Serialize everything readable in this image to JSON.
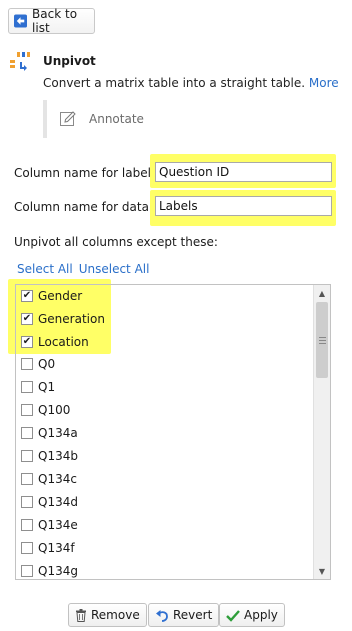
{
  "back_button": {
    "label": "Back to list"
  },
  "header": {
    "title": "Unpivot",
    "description": "Convert a matrix table into a straight table.",
    "more_link": "More"
  },
  "annotate": {
    "label": "Annotate"
  },
  "fields": {
    "labels_name": {
      "label": "Column name for labels",
      "value": "Question ID"
    },
    "data_name": {
      "label": "Column name for data",
      "value": "Labels"
    }
  },
  "columns_section": {
    "label": "Unpivot all columns except these:",
    "select_all": "Select All",
    "unselect_all": "Unselect All",
    "items": [
      {
        "label": "Gender",
        "checked": true
      },
      {
        "label": "Generation",
        "checked": true
      },
      {
        "label": "Location",
        "checked": true
      },
      {
        "label": "Q0",
        "checked": false
      },
      {
        "label": "Q1",
        "checked": false
      },
      {
        "label": "Q100",
        "checked": false
      },
      {
        "label": "Q134a",
        "checked": false
      },
      {
        "label": "Q134b",
        "checked": false
      },
      {
        "label": "Q134c",
        "checked": false
      },
      {
        "label": "Q134d",
        "checked": false
      },
      {
        "label": "Q134e",
        "checked": false
      },
      {
        "label": "Q134f",
        "checked": false
      },
      {
        "label": "Q134g",
        "checked": false
      }
    ]
  },
  "footer": {
    "remove": "Remove",
    "revert": "Revert",
    "apply": "Apply"
  },
  "colors": {
    "highlight": "#ffff66",
    "link": "#2a6fc9",
    "back_arrow": "#2f6fd0",
    "apply_check": "#2e9e3a"
  }
}
